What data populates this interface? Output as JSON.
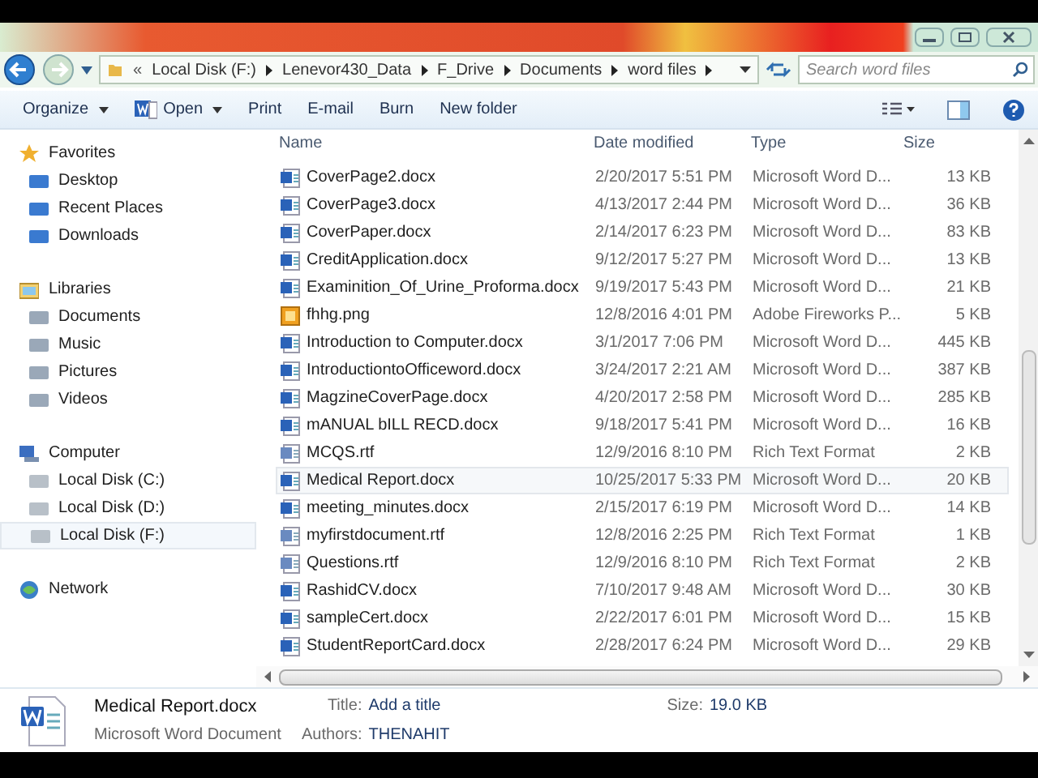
{
  "address": {
    "overflow": "«",
    "crumbs": [
      "Local Disk (F:)",
      "Lenevor430_Data",
      "F_Drive",
      "Documents",
      "word files"
    ]
  },
  "search": {
    "placeholder": "Search word files"
  },
  "toolbar": [
    {
      "label": "Organize",
      "dropdown": true,
      "icon": false
    },
    {
      "label": "Open",
      "dropdown": true,
      "icon": true
    },
    {
      "label": "Print",
      "dropdown": false,
      "icon": false
    },
    {
      "label": "E-mail",
      "dropdown": false,
      "icon": false
    },
    {
      "label": "Burn",
      "dropdown": false,
      "icon": false
    },
    {
      "label": "New folder",
      "dropdown": false,
      "icon": false
    }
  ],
  "sidebar": [
    {
      "label": "Favorites",
      "kind": "group",
      "selected": false,
      "children": [
        {
          "label": "Desktop",
          "selected": false
        },
        {
          "label": "Recent Places",
          "selected": false
        },
        {
          "label": "Downloads",
          "selected": false
        }
      ]
    },
    {
      "label": "Libraries",
      "kind": "group",
      "selected": false,
      "children": [
        {
          "label": "Documents",
          "selected": false
        },
        {
          "label": "Music",
          "selected": false
        },
        {
          "label": "Pictures",
          "selected": false
        },
        {
          "label": "Videos",
          "selected": false
        }
      ]
    },
    {
      "label": "Computer",
      "kind": "group",
      "selected": false,
      "children": [
        {
          "label": "Local Disk (C:)",
          "selected": false
        },
        {
          "label": "Local Disk (D:)",
          "selected": false
        },
        {
          "label": "Local Disk (F:)",
          "selected": true
        }
      ]
    },
    {
      "label": "Network",
      "kind": "group",
      "selected": false
    }
  ],
  "table": {
    "columns": [
      "Name",
      "Date modified",
      "Type",
      "Size"
    ],
    "rows": [
      {
        "kind": "word",
        "name": "CoverPage2.docx",
        "date": "2/20/2017 5:51 PM",
        "type": "Microsoft Word D...",
        "size": "13 KB",
        "selected": false
      },
      {
        "kind": "word",
        "name": "CoverPage3.docx",
        "date": "4/13/2017 2:44 PM",
        "type": "Microsoft Word D...",
        "size": "36 KB",
        "selected": false
      },
      {
        "kind": "word",
        "name": "CoverPaper.docx",
        "date": "2/14/2017 6:23 PM",
        "type": "Microsoft Word D...",
        "size": "83 KB",
        "selected": false
      },
      {
        "kind": "word",
        "name": "CreditApplication.docx",
        "date": "9/12/2017 5:27 PM",
        "type": "Microsoft Word D...",
        "size": "13 KB",
        "selected": false
      },
      {
        "kind": "word",
        "name": "Examinition_Of_Urine_Proforma.docx",
        "date": "9/19/2017 5:43 PM",
        "type": "Microsoft Word D...",
        "size": "21 KB",
        "selected": false
      },
      {
        "kind": "image",
        "name": "fhhg.png",
        "date": "12/8/2016 4:01 PM",
        "type": "Adobe Fireworks P...",
        "size": "5 KB",
        "selected": false
      },
      {
        "kind": "word",
        "name": "Introduction to Computer.docx",
        "date": "3/1/2017 7:06 PM",
        "type": "Microsoft Word D...",
        "size": "445 KB",
        "selected": false
      },
      {
        "kind": "word",
        "name": "IntroductiontoOfficeword.docx",
        "date": "3/24/2017 2:21 AM",
        "type": "Microsoft Word D...",
        "size": "387 KB",
        "selected": false
      },
      {
        "kind": "word",
        "name": "MagzineCoverPage.docx",
        "date": "4/20/2017 2:58 PM",
        "type": "Microsoft Word D...",
        "size": "285 KB",
        "selected": false
      },
      {
        "kind": "word",
        "name": "mANUAL bILL RECD.docx",
        "date": "9/18/2017 5:41 PM",
        "type": "Microsoft Word D...",
        "size": "16 KB",
        "selected": false
      },
      {
        "kind": "rtf",
        "name": "MCQS.rtf",
        "date": "12/9/2016 8:10 PM",
        "type": "Rich Text Format",
        "size": "2 KB",
        "selected": false
      },
      {
        "kind": "word",
        "name": "Medical Report.docx",
        "date": "10/25/2017 5:33 PM",
        "type": "Microsoft Word D...",
        "size": "20 KB",
        "selected": true
      },
      {
        "kind": "word",
        "name": "meeting_minutes.docx",
        "date": "2/15/2017 6:19 PM",
        "type": "Microsoft Word D...",
        "size": "14 KB",
        "selected": false
      },
      {
        "kind": "rtf",
        "name": "myfirstdocument.rtf",
        "date": "12/8/2016 2:25 PM",
        "type": "Rich Text Format",
        "size": "1 KB",
        "selected": false
      },
      {
        "kind": "rtf",
        "name": "Questions.rtf",
        "date": "12/9/2016 8:10 PM",
        "type": "Rich Text Format",
        "size": "2 KB",
        "selected": false
      },
      {
        "kind": "word",
        "name": "RashidCV.docx",
        "date": "7/10/2017 9:48 AM",
        "type": "Microsoft Word D...",
        "size": "30 KB",
        "selected": false
      },
      {
        "kind": "word",
        "name": "sampleCert.docx",
        "date": "2/22/2017 6:01 PM",
        "type": "Microsoft Word D...",
        "size": "15 KB",
        "selected": false
      },
      {
        "kind": "word",
        "name": "StudentReportCard.docx",
        "date": "2/28/2017 6:24 PM",
        "type": "Microsoft Word D...",
        "size": "29 KB",
        "selected": false
      }
    ]
  },
  "details": {
    "name": "Medical Report.docx",
    "type": "Microsoft Word Document",
    "fields": [
      {
        "label": "Title:",
        "value": "Add a title"
      },
      {
        "label": "Authors:",
        "value": "THENAHIT"
      },
      {
        "label": "Size:",
        "value": "19.0 KB"
      }
    ]
  }
}
